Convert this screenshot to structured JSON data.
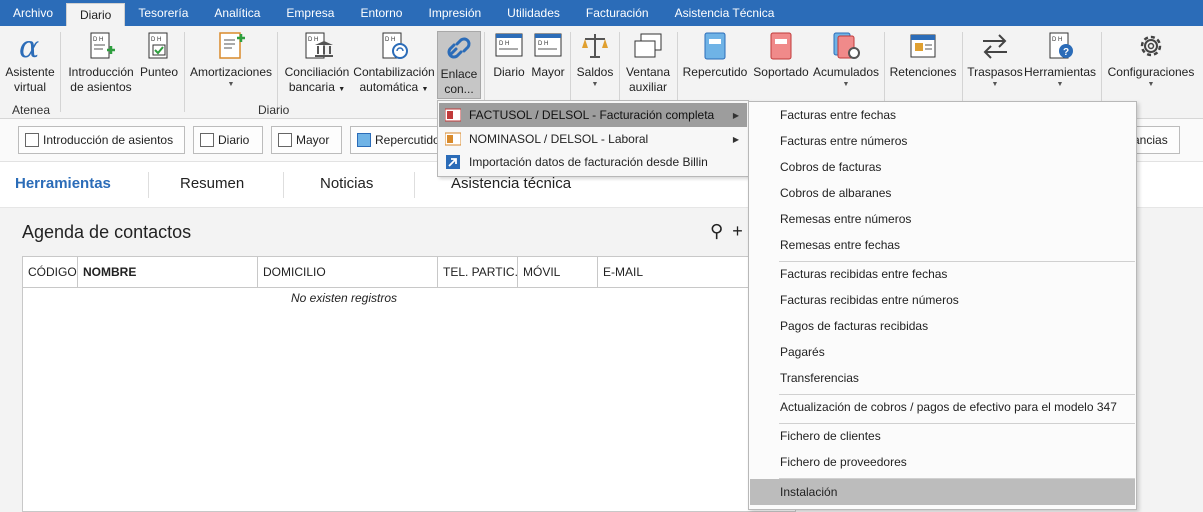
{
  "menubar": {
    "tabs": [
      "Archivo",
      "Diario",
      "Tesorería",
      "Analítica",
      "Empresa",
      "Entorno",
      "Impresión",
      "Utilidades",
      "Facturación",
      "Asistencia Técnica"
    ],
    "active": "Diario"
  },
  "ribbon": {
    "buttons": {
      "asistente": [
        "Asistente",
        "virtual"
      ],
      "introduccion": [
        "Introducción",
        "de asientos"
      ],
      "punteo": "Punteo",
      "amortizaciones": "Amortizaciones",
      "conciliacion": [
        "Conciliación",
        "bancaria"
      ],
      "contabilizacion": [
        "Contabilización",
        "automática"
      ],
      "enlace": [
        "Enlace",
        "con..."
      ],
      "diario": "Diario",
      "mayor": "Mayor",
      "saldos": "Saldos",
      "ventana": [
        "Ventana",
        "auxiliar"
      ],
      "repercutido": "Repercutido",
      "soportado": "Soportado",
      "acumulados": "Acumulados",
      "retenciones": "Retenciones",
      "traspasos": "Traspasos",
      "herramientas": "Herramientas",
      "configuraciones": "Configuraciones"
    },
    "groups": {
      "atenea": "Atenea",
      "diario": "Diario"
    }
  },
  "quickbar": {
    "introduccion": "Introducción de asientos",
    "diario": "Diario",
    "mayor": "Mayor",
    "repercutido": "Repercutido",
    "tail": "ancias"
  },
  "sections": {
    "tabs": [
      "Herramientas",
      "Resumen",
      "Noticias",
      "Asistencia técnica"
    ],
    "active": "Herramientas"
  },
  "agenda": {
    "title": "Agenda de contactos",
    "columns": [
      "CÓDIGO",
      "NOMBRE",
      "DOMICILIO",
      "TEL. PARTIC...",
      "MÓVIL",
      "E-MAIL"
    ],
    "empty": "No existen registros"
  },
  "dropdown": {
    "items": [
      "FACTUSOL / DELSOL - Facturación completa",
      "NOMINASOL / DELSOL - Laboral",
      "Importación datos de facturación desde Billin"
    ]
  },
  "submenu": {
    "items": [
      "Facturas entre fechas",
      "Facturas entre números",
      "Cobros de facturas",
      "Cobros de albaranes",
      "Remesas entre números",
      "Remesas entre fechas",
      "Facturas recibidas entre fechas",
      "Facturas recibidas entre números",
      "Pagos de facturas recibidas",
      "Pagarés",
      "Transferencias",
      "Actualización de cobros / pagos de efectivo para el modelo 347",
      "Fichero de clientes",
      "Fichero de proveedores",
      "Instalación"
    ]
  },
  "colors": {
    "accent": "#2b6cb8",
    "highlight": "#9d9d9d",
    "green_plus": "#2e9e3e"
  }
}
